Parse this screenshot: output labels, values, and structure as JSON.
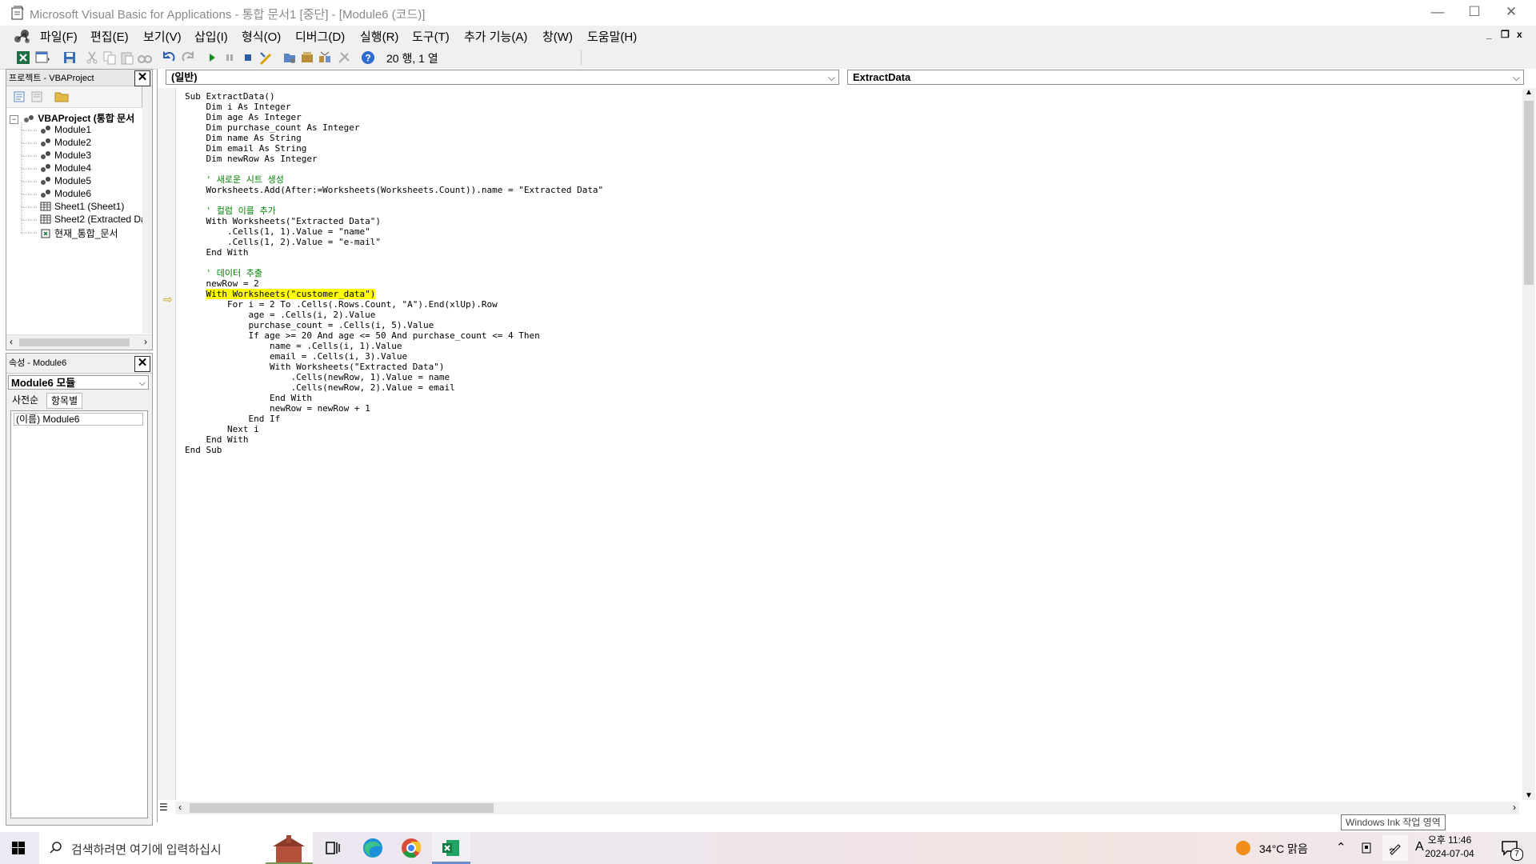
{
  "window": {
    "title": "Microsoft Visual Basic for Applications - 통합 문서1 [중단] - [Module6 (코드)]",
    "minimize": "—",
    "maximize": "☐",
    "close": "✕"
  },
  "menubar": {
    "items": [
      "파일(F)",
      "편집(E)",
      "보기(V)",
      "삽입(I)",
      "형식(O)",
      "디버그(D)",
      "실행(R)",
      "도구(T)",
      "추가 기능(A)",
      "창(W)",
      "도움말(H)"
    ],
    "mdi_min": "_",
    "mdi_restore": "❐",
    "mdi_close": "x"
  },
  "toolbar": {
    "position": "20 행, 1 열"
  },
  "project": {
    "title": "프로젝트 - VBAProject",
    "root": "VBAProject (통합 문서",
    "items": [
      "Module1",
      "Module2",
      "Module3",
      "Module4",
      "Module5",
      "Module6",
      "Sheet1 (Sheet1)",
      "Sheet2 (Extracted Da",
      "현재_통합_문서"
    ]
  },
  "properties": {
    "title": "속성 - Module6",
    "object": "Module6 모듈",
    "tab_alpha": "사전순",
    "tab_category": "항목별",
    "row": "(이름) Module6"
  },
  "code": {
    "object_combo": "(일반)",
    "procedure_combo": "ExtractData",
    "lines": [
      "Sub ExtractData()",
      "    Dim i As Integer",
      "    Dim age As Integer",
      "    Dim purchase_count As Integer",
      "    Dim name As String",
      "    Dim email As String",
      "    Dim newRow As Integer",
      "",
      "    ' 새로운 시트 생성",
      "    Worksheets.Add(After:=Worksheets(Worksheets.Count)).name = \"Extracted Data\"",
      "",
      "    ' 컬럼 이름 추가",
      "    With Worksheets(\"Extracted Data\")",
      "        .Cells(1, 1).Value = \"name\"",
      "        .Cells(1, 2).Value = \"e-mail\"",
      "    End With",
      "",
      "    ' 데이터 추출",
      "    newRow = 2",
      "    With Worksheets(\"customer_data\")",
      "        For i = 2 To .Cells(.Rows.Count, \"A\").End(xlUp).Row",
      "            age = .Cells(i, 2).Value",
      "            purchase_count = .Cells(i, 5).Value",
      "            If age >= 20 And age <= 50 And purchase_count <= 4 Then",
      "                name = .Cells(i, 1).Value",
      "                email = .Cells(i, 3).Value",
      "                With Worksheets(\"Extracted Data\")",
      "                    .Cells(newRow, 1).Value = name",
      "                    .Cells(newRow, 2).Value = email",
      "                End With",
      "                newRow = newRow + 1",
      "            End If",
      "        Next i",
      "    End With",
      "End Sub"
    ],
    "highlighted_line": 19
  },
  "tooltip": "Windows Ink 작업 영역",
  "taskbar": {
    "search_placeholder": "검색하려면 여기에 입력하십시",
    "weather": "34°C 맑음",
    "ime": "A",
    "time": "오후 11:46",
    "date": "2024-07-04",
    "notification_count": "7"
  }
}
